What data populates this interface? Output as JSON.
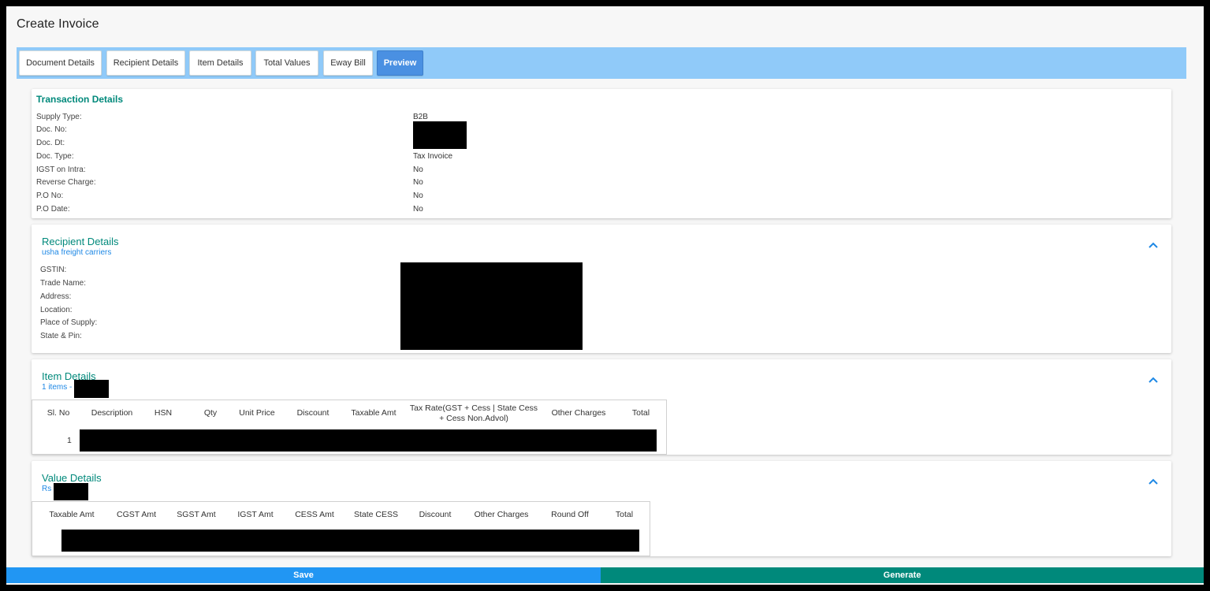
{
  "page": {
    "title": "Create Invoice"
  },
  "tabs": [
    {
      "label": "Document Details"
    },
    {
      "label": "Recipient Details"
    },
    {
      "label": "Item Details"
    },
    {
      "label": "Total Values"
    },
    {
      "label": "Eway Bill"
    },
    {
      "label": "Preview"
    }
  ],
  "transaction": {
    "title": "Transaction Details",
    "rows": [
      {
        "label": "Supply Type:",
        "value": "B2B"
      },
      {
        "label": "Doc. No:",
        "value": ""
      },
      {
        "label": "Doc. Dt:",
        "value": ""
      },
      {
        "label": "Doc. Type:",
        "value": "Tax Invoice"
      },
      {
        "label": "IGST on Intra:",
        "value": "No"
      },
      {
        "label": "Reverse Charge:",
        "value": "No"
      },
      {
        "label": "P.O No:",
        "value": "No"
      },
      {
        "label": "P.O Date:",
        "value": "No"
      }
    ]
  },
  "recipient": {
    "title": "Recipient Details",
    "subtitle": "usha freight carriers",
    "rows": [
      {
        "label": "GSTIN:"
      },
      {
        "label": "Trade Name:"
      },
      {
        "label": "Address:"
      },
      {
        "label": "Location:"
      },
      {
        "label": "Place of Supply:"
      },
      {
        "label": "State & Pin:"
      }
    ]
  },
  "items": {
    "title": "Item Details",
    "subtitle": "1 items -",
    "columns": [
      "Sl. No",
      "Description",
      "HSN",
      "Qty",
      "Unit Price",
      "Discount",
      "Taxable Amt",
      "Tax Rate(GST + Cess | State Cess + Cess Non.Advol)",
      "Other Charges",
      "Total"
    ],
    "rows": [
      {
        "sl_no": "1"
      }
    ]
  },
  "values": {
    "title": "Value Details",
    "subtitle": "Rs",
    "columns": [
      "Taxable Amt",
      "CGST Amt",
      "SGST Amt",
      "IGST Amt",
      "CESS Amt",
      "State CESS",
      "Discount",
      "Other Charges",
      "Round Off",
      "Total"
    ]
  },
  "actions": {
    "save_label": "Save",
    "generate_label": "Generate"
  },
  "colors": {
    "tabbar": "#90caf9",
    "active_tab": "#4a90e2",
    "teal": "#00897b",
    "link_blue": "#1e88e5",
    "save": "#2196f3",
    "generate": "#00897b"
  }
}
